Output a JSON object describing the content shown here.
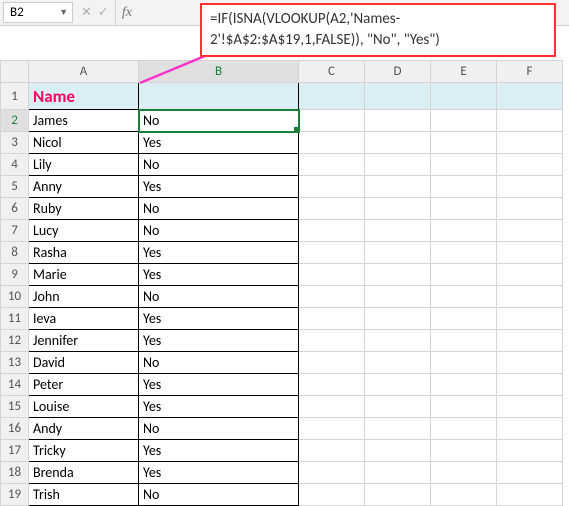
{
  "namebox": {
    "value": "B2"
  },
  "formula_bar": {
    "formula": "=IF(ISNA(VLOOKUP(A2,'Names-2'!$A$2:$A$19,1,FALSE)), \"No\", \"Yes\")"
  },
  "columns": [
    "A",
    "B",
    "C",
    "D",
    "E",
    "F"
  ],
  "header_row": {
    "name_label": "Name"
  },
  "rows": [
    {
      "n": 2,
      "name": "James",
      "val": "No"
    },
    {
      "n": 3,
      "name": "Nicol",
      "val": "Yes"
    },
    {
      "n": 4,
      "name": "Lily",
      "val": "No"
    },
    {
      "n": 5,
      "name": "Anny",
      "val": "Yes"
    },
    {
      "n": 6,
      "name": "Ruby",
      "val": "No"
    },
    {
      "n": 7,
      "name": "Lucy",
      "val": "No"
    },
    {
      "n": 8,
      "name": "Rasha",
      "val": "Yes"
    },
    {
      "n": 9,
      "name": "Marie",
      "val": "Yes"
    },
    {
      "n": 10,
      "name": "John",
      "val": "No"
    },
    {
      "n": 11,
      "name": "Ieva",
      "val": "Yes"
    },
    {
      "n": 12,
      "name": "Jennifer",
      "val": "Yes"
    },
    {
      "n": 13,
      "name": "David",
      "val": "No"
    },
    {
      "n": 14,
      "name": "Peter",
      "val": "Yes"
    },
    {
      "n": 15,
      "name": "Louise",
      "val": "Yes"
    },
    {
      "n": 16,
      "name": "Andy",
      "val": "No"
    },
    {
      "n": 17,
      "name": "Tricky",
      "val": "Yes"
    },
    {
      "n": 18,
      "name": "Brenda",
      "val": "Yes"
    },
    {
      "n": 19,
      "name": "Trish",
      "val": "No"
    }
  ],
  "selected_cell": "B2",
  "icons": {
    "cancel": "✕",
    "confirm": "✓",
    "fx": "fx",
    "dropdown": "▼"
  }
}
